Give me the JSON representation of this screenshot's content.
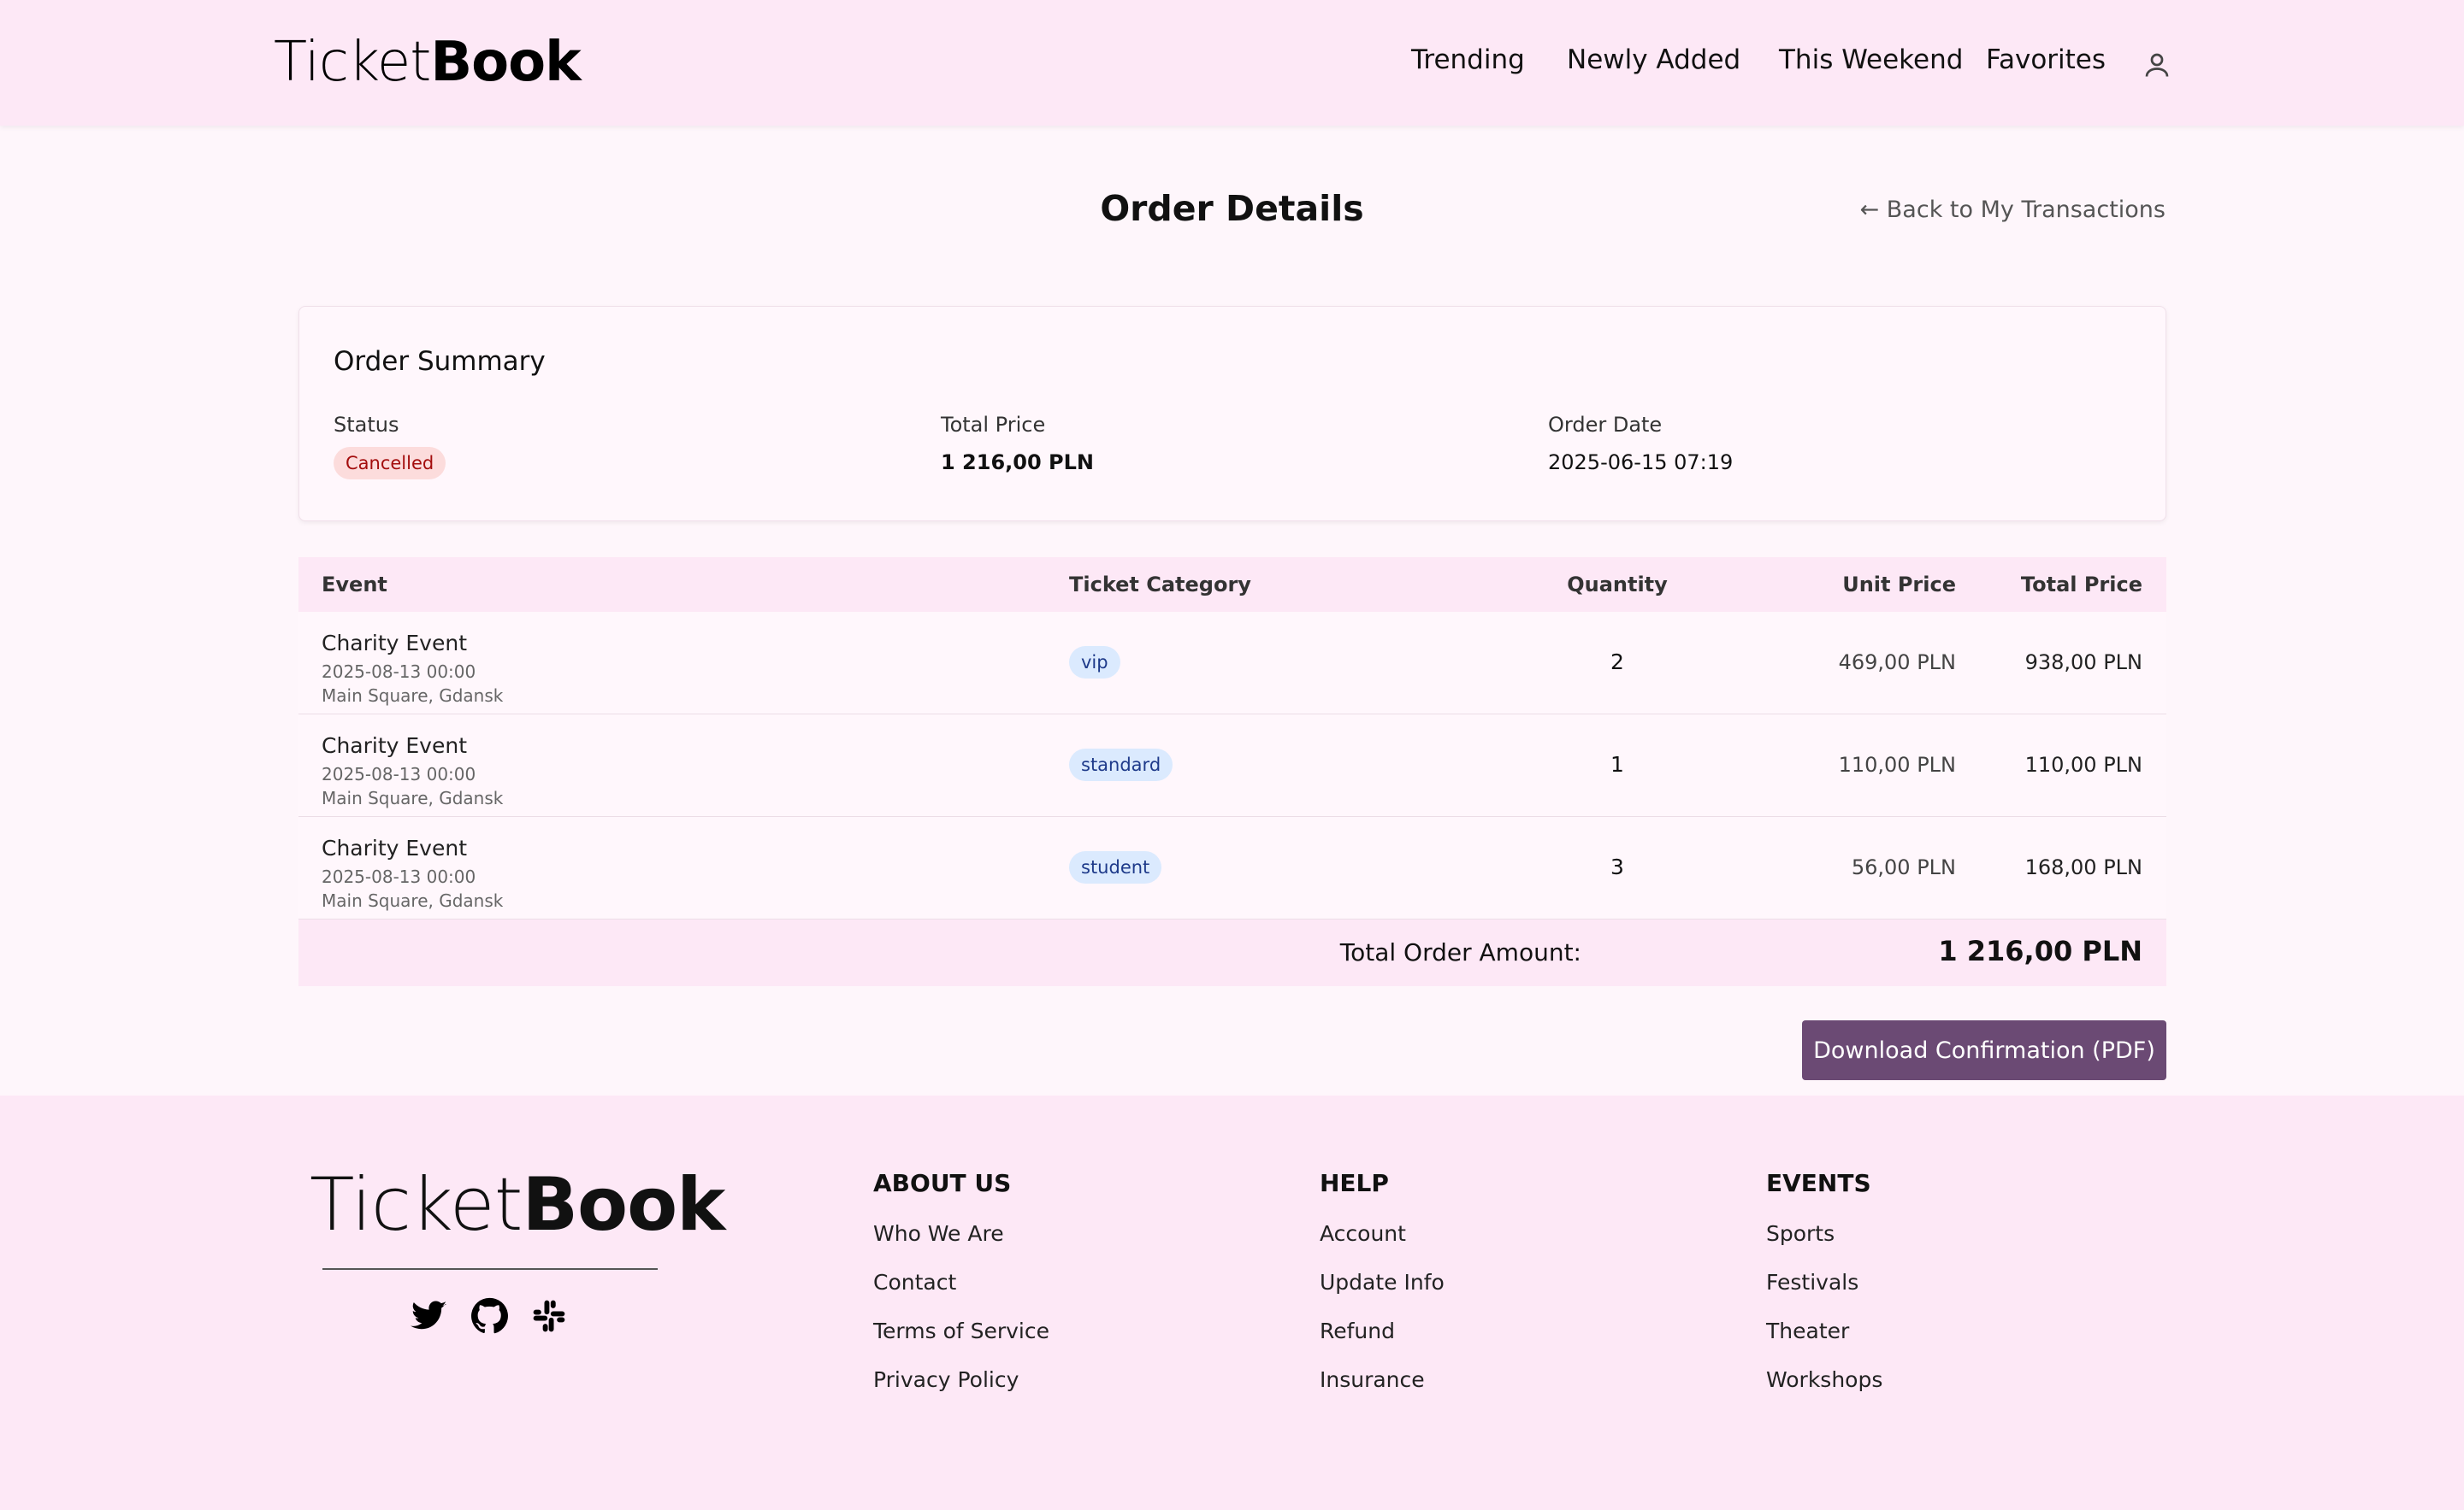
{
  "header": {
    "logo_light": "Ticket",
    "logo_bold": "Book",
    "nav": [
      "Trending",
      "Newly Added",
      "This Weekend",
      "Favorites"
    ],
    "user_icon": "user-icon"
  },
  "page": {
    "title": "Order Details",
    "back_link": "← Back to My Transactions"
  },
  "summary": {
    "title": "Order Summary",
    "status_label": "Status",
    "status_value": "Cancelled",
    "total_price_label": "Total Price",
    "total_price_value": "1 216,00 PLN",
    "order_date_label": "Order Date",
    "order_date_value": "2025-06-15 07:19"
  },
  "table": {
    "headers": {
      "event": "Event",
      "category": "Ticket Category",
      "quantity": "Quantity",
      "unit_price": "Unit Price",
      "total_price": "Total Price"
    },
    "rows": [
      {
        "event": "Charity Event",
        "date": "2025-08-13 00:00",
        "location": "Main Square, Gdansk",
        "category": "vip",
        "quantity": "2",
        "unit_price": "469,00 PLN",
        "total_price": "938,00 PLN"
      },
      {
        "event": "Charity Event",
        "date": "2025-08-13 00:00",
        "location": "Main Square, Gdansk",
        "category": "standard",
        "quantity": "1",
        "unit_price": "110,00 PLN",
        "total_price": "110,00 PLN"
      },
      {
        "event": "Charity Event",
        "date": "2025-08-13 00:00",
        "location": "Main Square, Gdansk",
        "category": "student",
        "quantity": "3",
        "unit_price": "56,00 PLN",
        "total_price": "168,00 PLN"
      }
    ],
    "total_label": "Total Order Amount:",
    "total_value": "1 216,00 PLN"
  },
  "download_button": "Download Confirmation (PDF)",
  "footer": {
    "logo_light": "Ticket",
    "logo_bold": "Book",
    "social_icons": [
      "twitter-icon",
      "github-icon",
      "slack-icon"
    ],
    "columns": [
      {
        "heading": "ABOUT US",
        "links": [
          "Who We Are",
          "Contact",
          "Terms of Service",
          "Privacy Policy"
        ]
      },
      {
        "heading": "HELP",
        "links": [
          "Account",
          "Update Info",
          "Refund",
          "Insurance"
        ]
      },
      {
        "heading": "EVENTS",
        "links": [
          "Sports",
          "Festivals",
          "Theater",
          "Workshops"
        ]
      }
    ]
  },
  "colors": {
    "header_bg": "#fde8f6",
    "page_bg": "#fef6fb",
    "button_bg": "#6b4a74",
    "cancelled_bg": "#fcdcdc",
    "cancelled_text": "#a30d0d",
    "category_bg": "#dbeafe",
    "category_text": "#1e3a8a"
  }
}
